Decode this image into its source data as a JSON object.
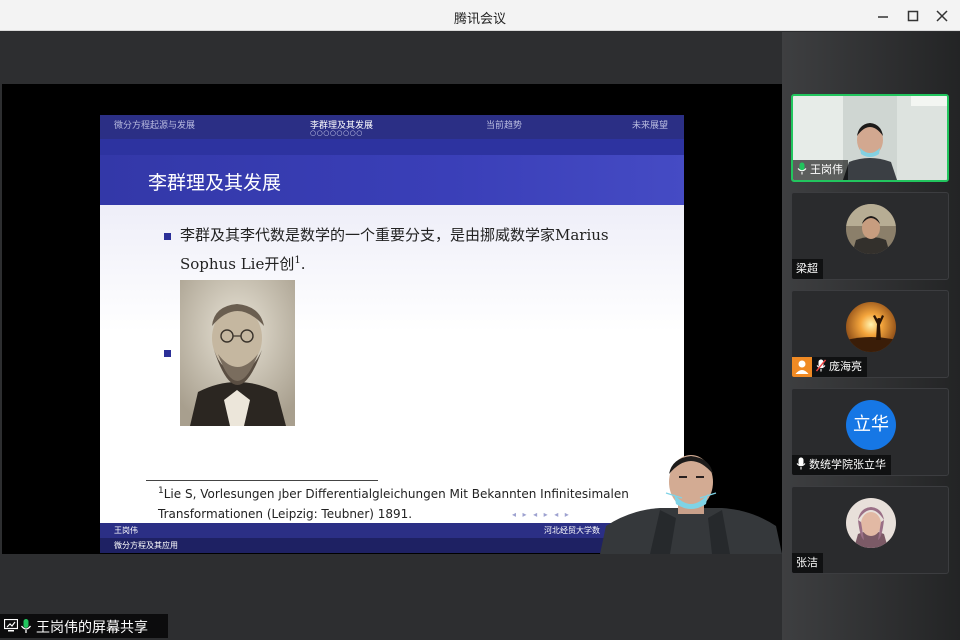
{
  "window": {
    "title": "腾讯会议"
  },
  "slide": {
    "nav": {
      "sections": [
        "微分方程起源与发展",
        "李群理及其发展",
        "当前趋势",
        "未来展望"
      ],
      "active_index": 1,
      "dots": "○○○○○○○○"
    },
    "frame_title": "李群理及其发展",
    "bullet1": "李群及其李代数是数学的一个重要分支，是由挪威数学家Marius Sophus Lie开创",
    "bullet1_sup": "1",
    "bullet1_end": ".",
    "footnote_mark": "1",
    "footnote": "Lie S, Vorlesungen ȷber Differentialgleichungen Mit Bekannten Infinitesimalen Transformationen (Leipzig: Teubner) 1891.",
    "nav_symbols": "◂ ▸ ◂ ▸ ◂ ▸",
    "footer_author": "王岗伟",
    "footer_institute": "河北经贸大学数",
    "footer_title": "微分方程及其应用"
  },
  "share_bar": {
    "label": "王岗伟的屏幕共享"
  },
  "participants": [
    {
      "name": "王岗伟",
      "type": "video",
      "active": true,
      "mic": true
    },
    {
      "name": "梁超",
      "type": "photo"
    },
    {
      "name": "庞海亮",
      "type": "photo",
      "host": true,
      "mic": true
    },
    {
      "name": "数统学院张立华",
      "type": "text",
      "avatar_text": "立华",
      "mic": true
    },
    {
      "name": "张洁",
      "type": "photo"
    }
  ],
  "colors": {
    "beamer_blue": "#2b2f85",
    "active_speaker": "#22c55e",
    "text_avatar": "#1677e5",
    "host_badge": "#f08a24"
  }
}
